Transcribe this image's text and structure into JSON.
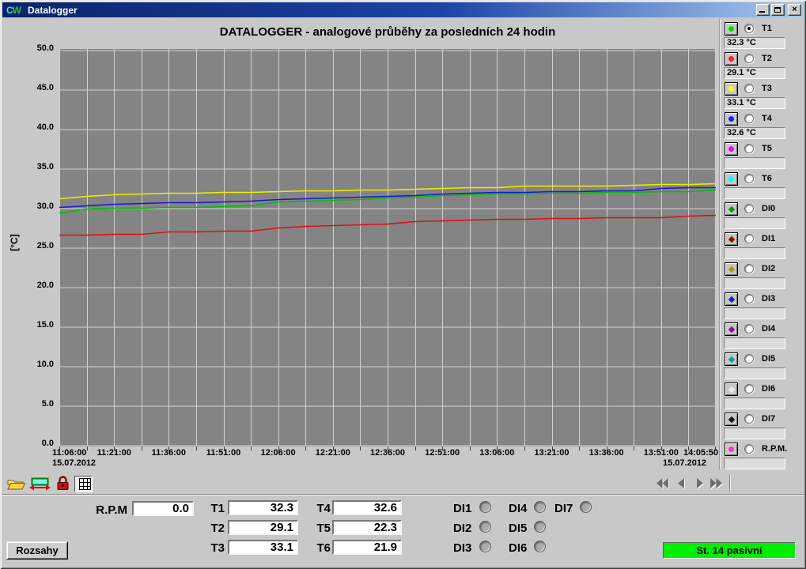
{
  "window": {
    "title": "Datalogger",
    "icon_c": "C",
    "icon_w": "W",
    "controls": [
      "minimize-icon",
      "maximize-icon",
      "close-icon"
    ]
  },
  "chart": {
    "title": "DATALOGGER - analogové průběhy za posledních 24 hodin",
    "unit_label": "[°C]",
    "date_left": "15.07.2012",
    "date_right": "15.07.2012"
  },
  "chart_data": {
    "type": "line",
    "title": "DATALOGGER - analogové průběhy za posledních 24 hodin",
    "ylabel": "[°C]",
    "ylim": [
      0,
      50
    ],
    "y_ticks": [
      0,
      5,
      10,
      15,
      20,
      25,
      30,
      35,
      40,
      45,
      50
    ],
    "x_ticks": [
      "11:06:00",
      "11:21:00",
      "11:36:00",
      "11:51:00",
      "12:06:00",
      "12:21:00",
      "12:36:00",
      "12:51:00",
      "13:06:00",
      "13:21:00",
      "13:36:00",
      "13:51:00",
      "14:05:50"
    ],
    "date": "15.07.2012",
    "grid": true,
    "plot_bg": "#848484",
    "grid_color": "#d2d2d2",
    "legend_position": "right",
    "series": [
      {
        "name": "T1",
        "color": "#00c000",
        "values": [
          29.4,
          29.9,
          30.0,
          30.0,
          30.1,
          30.1,
          30.2,
          30.3,
          30.8,
          30.9,
          31.0,
          31.1,
          31.3,
          31.4,
          31.6,
          31.7,
          31.8,
          31.8,
          31.9,
          31.9,
          32.0,
          32.0,
          32.1,
          32.1,
          32.3
        ]
      },
      {
        "name": "T2",
        "color": "#dd1010",
        "values": [
          26.6,
          26.6,
          26.7,
          26.7,
          27.0,
          27.0,
          27.1,
          27.1,
          27.5,
          27.7,
          27.8,
          27.9,
          28.0,
          28.3,
          28.4,
          28.5,
          28.6,
          28.6,
          28.7,
          28.7,
          28.8,
          28.8,
          28.8,
          29.0,
          29.1
        ]
      },
      {
        "name": "T4",
        "color": "#1818d8",
        "values": [
          30.1,
          30.3,
          30.5,
          30.6,
          30.7,
          30.7,
          30.8,
          30.9,
          31.1,
          31.2,
          31.3,
          31.4,
          31.5,
          31.6,
          31.8,
          31.9,
          32.0,
          32.0,
          32.1,
          32.1,
          32.2,
          32.2,
          32.5,
          32.6,
          32.6
        ]
      },
      {
        "name": "T3",
        "color": "#eded00",
        "values": [
          31.2,
          31.5,
          31.7,
          31.8,
          31.9,
          31.9,
          32.0,
          32.0,
          32.1,
          32.2,
          32.2,
          32.3,
          32.3,
          32.4,
          32.5,
          32.6,
          32.6,
          32.8,
          32.8,
          32.8,
          32.8,
          32.9,
          33.0,
          33.0,
          33.1
        ]
      }
    ]
  },
  "sidebar": {
    "channels": [
      {
        "label": "T1",
        "value": "32.3 °C",
        "color": "#00e000",
        "dot": "round",
        "selected": true
      },
      {
        "label": "T2",
        "value": "29.1 °C",
        "color": "#ff2020",
        "dot": "round",
        "selected": false
      },
      {
        "label": "T3",
        "value": "33.1 °C",
        "color": "#ffff00",
        "dot": "round",
        "selected": false
      },
      {
        "label": "T4",
        "value": "32.6 °C",
        "color": "#2020ff",
        "dot": "round",
        "selected": false
      },
      {
        "label": "T5",
        "value": "",
        "color": "#ff00ff",
        "dot": "round",
        "selected": false
      },
      {
        "label": "T6",
        "value": "",
        "color": "#00ffff",
        "dot": "round",
        "selected": false
      },
      {
        "label": "DI0",
        "value": "",
        "color": "#00a000",
        "dot": "diamond",
        "selected": false
      },
      {
        "label": "DI1",
        "value": "",
        "color": "#a00000",
        "dot": "diamond",
        "selected": false
      },
      {
        "label": "DI2",
        "value": "",
        "color": "#a0a000",
        "dot": "diamond",
        "selected": false
      },
      {
        "label": "DI3",
        "value": "",
        "color": "#2020b0",
        "dot": "diamond",
        "selected": false
      },
      {
        "label": "DI4",
        "value": "",
        "color": "#a000a0",
        "dot": "diamond",
        "selected": false
      },
      {
        "label": "DI5",
        "value": "",
        "color": "#00a0a0",
        "dot": "diamond",
        "selected": false
      },
      {
        "label": "DI6",
        "value": "",
        "color": "#ececec",
        "dot": "diamond",
        "selected": false
      },
      {
        "label": "DI7",
        "value": "",
        "color": "#181818",
        "dot": "diamond",
        "selected": false
      },
      {
        "label": "R.P.M.",
        "value": "",
        "color": "#ff30dd",
        "dot": "round",
        "selected": false
      }
    ]
  },
  "toolbar": {
    "icons": [
      "open-folder-icon",
      "pan-range-icon",
      "lock-icon",
      "grid-icon"
    ],
    "nav": [
      "fast-back",
      "back",
      "forward",
      "fast-forward"
    ]
  },
  "panel": {
    "rpm_label": "R.P.M",
    "rpm_value": "0.0",
    "temps": [
      {
        "label": "T1",
        "value": "32.3"
      },
      {
        "label": "T2",
        "value": "29.1"
      },
      {
        "label": "T3",
        "value": "33.1"
      },
      {
        "label": "T4",
        "value": "32.6"
      },
      {
        "label": "T5",
        "value": "22.3"
      },
      {
        "label": "T6",
        "value": "21.9"
      }
    ],
    "digital_inputs": [
      "DI1",
      "DI2",
      "DI3",
      "DI4",
      "DI5",
      "DI6",
      "DI7"
    ]
  },
  "footer": {
    "rozsahy_button": "Rozsahy",
    "status_text": "St. 14 pasivní",
    "status_color": "#00ee00"
  }
}
